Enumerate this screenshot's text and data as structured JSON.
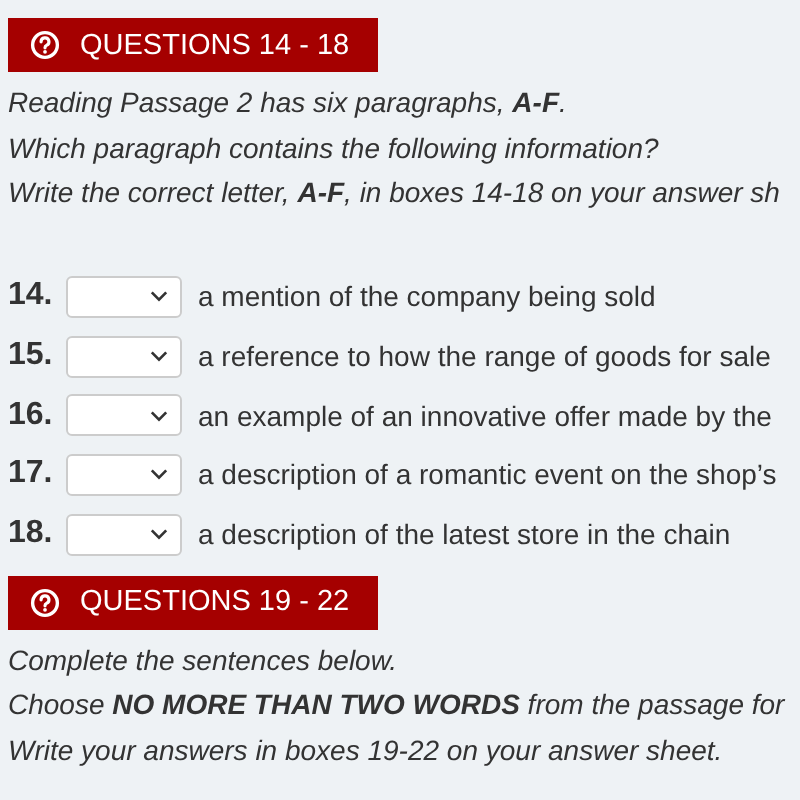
{
  "sections": [
    {
      "heading": "QUESTIONS 14 - 18",
      "instructions": [
        "Reading Passage 2 has six paragraphs, **A-F**.",
        "Which paragraph contains the following information?",
        "Write the correct letter, **A-F**, in boxes 14-18 on your answer sh"
      ],
      "questions": [
        {
          "number": "14.",
          "text": "a mention of the company being sold"
        },
        {
          "number": "15.",
          "text": "a reference to how the range of goods for sale"
        },
        {
          "number": "16.",
          "text": "an example of an innovative offer made by the"
        },
        {
          "number": "17.",
          "text": "a description of a romantic event on the shop’s"
        },
        {
          "number": "18.",
          "text": "a description of the latest store in the chain"
        }
      ]
    },
    {
      "heading": "QUESTIONS 19 - 22",
      "instructions": [
        "Complete the sentences below.",
        "Choose **NO MORE THAN TWO WORDS** from the passage for",
        "Write your answers in boxes 19-22 on your answer sheet."
      ]
    }
  ]
}
